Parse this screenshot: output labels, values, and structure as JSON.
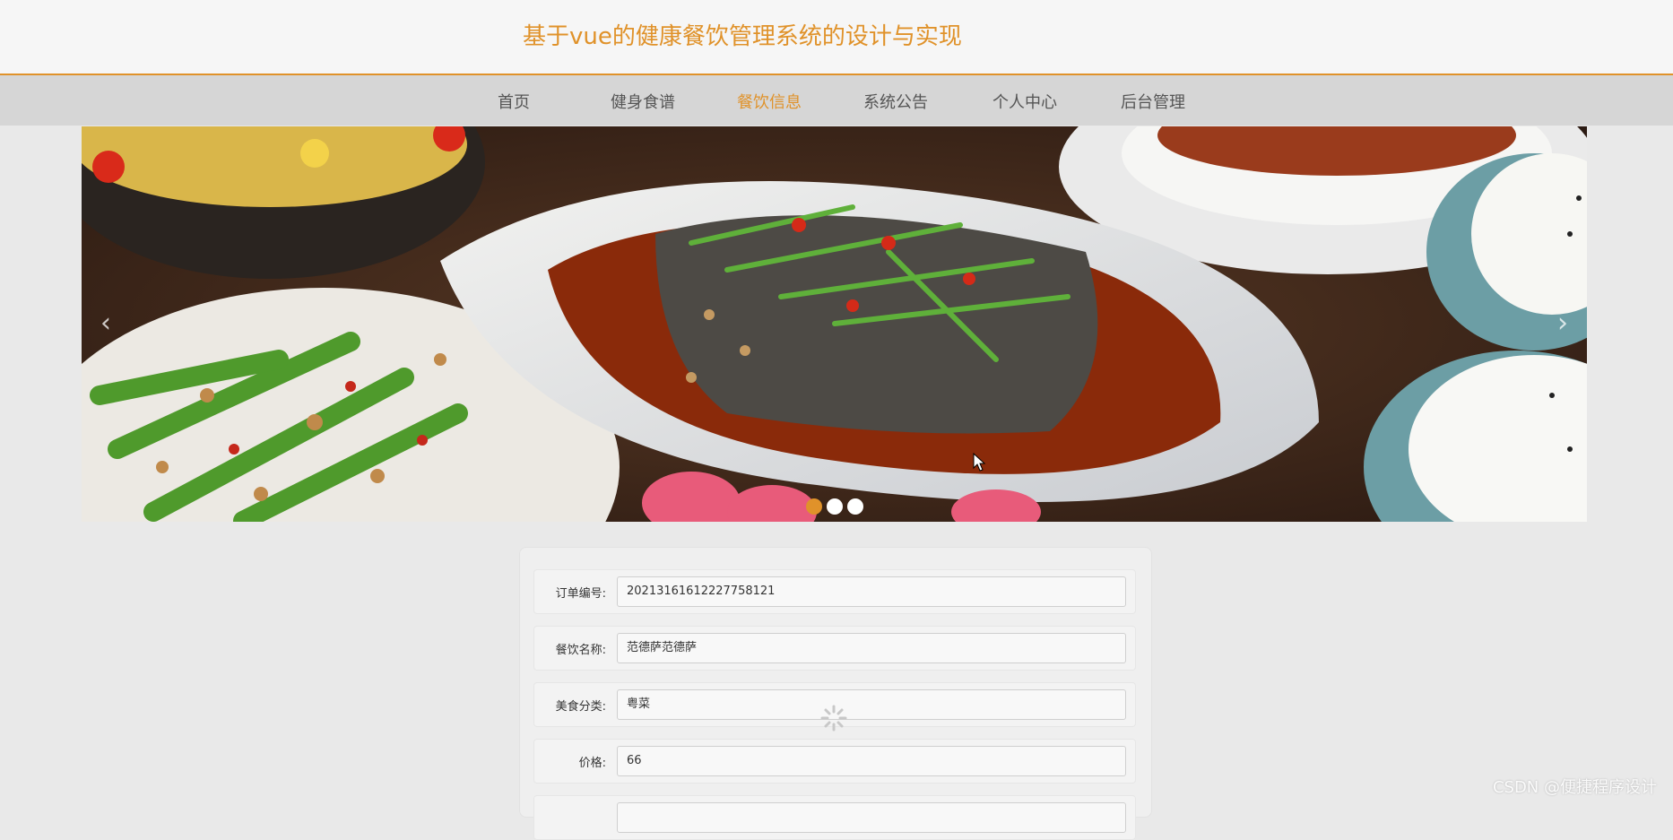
{
  "header": {
    "title": "基于vue的健康餐饮管理系统的设计与实现"
  },
  "nav": {
    "items": [
      {
        "label": "首页"
      },
      {
        "label": "健身食谱"
      },
      {
        "label": "餐饮信息",
        "active": true
      },
      {
        "label": "系统公告"
      },
      {
        "label": "个人中心"
      },
      {
        "label": "后台管理"
      }
    ],
    "accent_color": "#e0922a"
  },
  "banner": {
    "image": "food-dishes-photo",
    "prev_icon": "chevron-left-icon",
    "next_icon": "chevron-right-icon",
    "slide_count": 3,
    "active_slide": 1
  },
  "form": {
    "fields": [
      {
        "label": "订单编号:",
        "value": "20213161612227758121"
      },
      {
        "label": "餐饮名称:",
        "value": "范德萨范德萨"
      },
      {
        "label": "美食分类:",
        "value": "粤菜"
      },
      {
        "label": "价格:",
        "value": "66"
      }
    ]
  },
  "watermark": "CSDN @便捷程序设计"
}
